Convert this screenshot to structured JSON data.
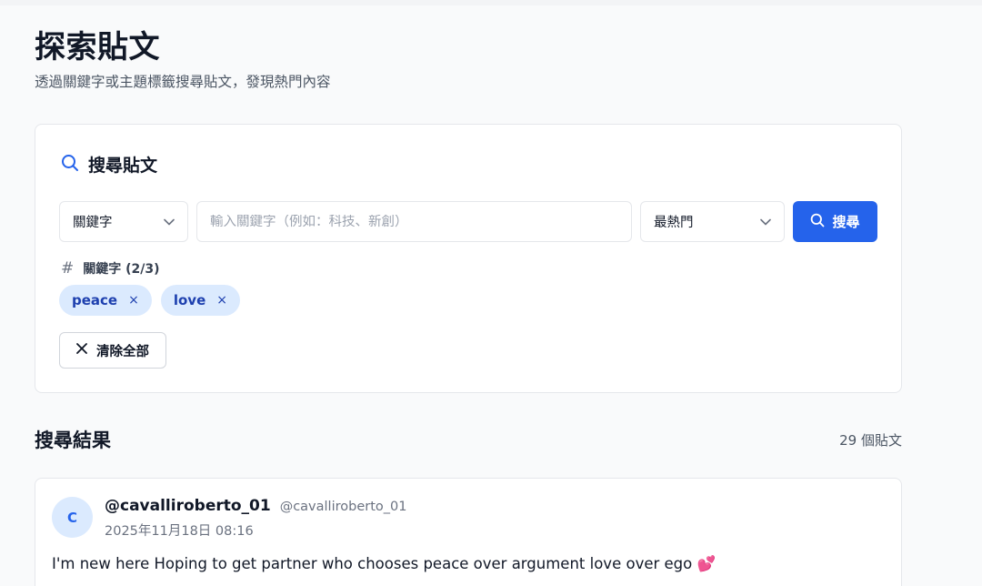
{
  "page": {
    "title": "探索貼文",
    "subtitle": "透過關鍵字或主題標籤搜尋貼文，發現熱門內容"
  },
  "search": {
    "heading": "搜尋貼文",
    "type_select": {
      "value": "關鍵字",
      "icon": "chevron-down-icon"
    },
    "keyword_input": {
      "value": "",
      "placeholder": "輸入關鍵字（例如：科技、新創）"
    },
    "sort_select": {
      "value": "最熱門",
      "icon": "chevron-down-icon"
    },
    "search_button": "搜尋",
    "keywords_label": "關鍵字 (2/3)",
    "keywords": [
      {
        "label": "peace",
        "remove": "×"
      },
      {
        "label": "love",
        "remove": "×"
      }
    ],
    "clear_button": "清除全部"
  },
  "results": {
    "title": "搜尋結果",
    "count": "29 個貼文",
    "posts": [
      {
        "avatar": "C",
        "display_name": "@cavalliroberto_01",
        "handle": "@cavalliroberto_01",
        "time": "2025年11月18日 08:16",
        "text": "I'm new here Hoping to get partner who chooses peace over argument love over ego",
        "emoji": "💕"
      }
    ]
  },
  "colors": {
    "accent": "#2563eb",
    "tag_bg": "#dbeafe",
    "tag_text": "#1e40af",
    "background": "#f9fafb"
  }
}
